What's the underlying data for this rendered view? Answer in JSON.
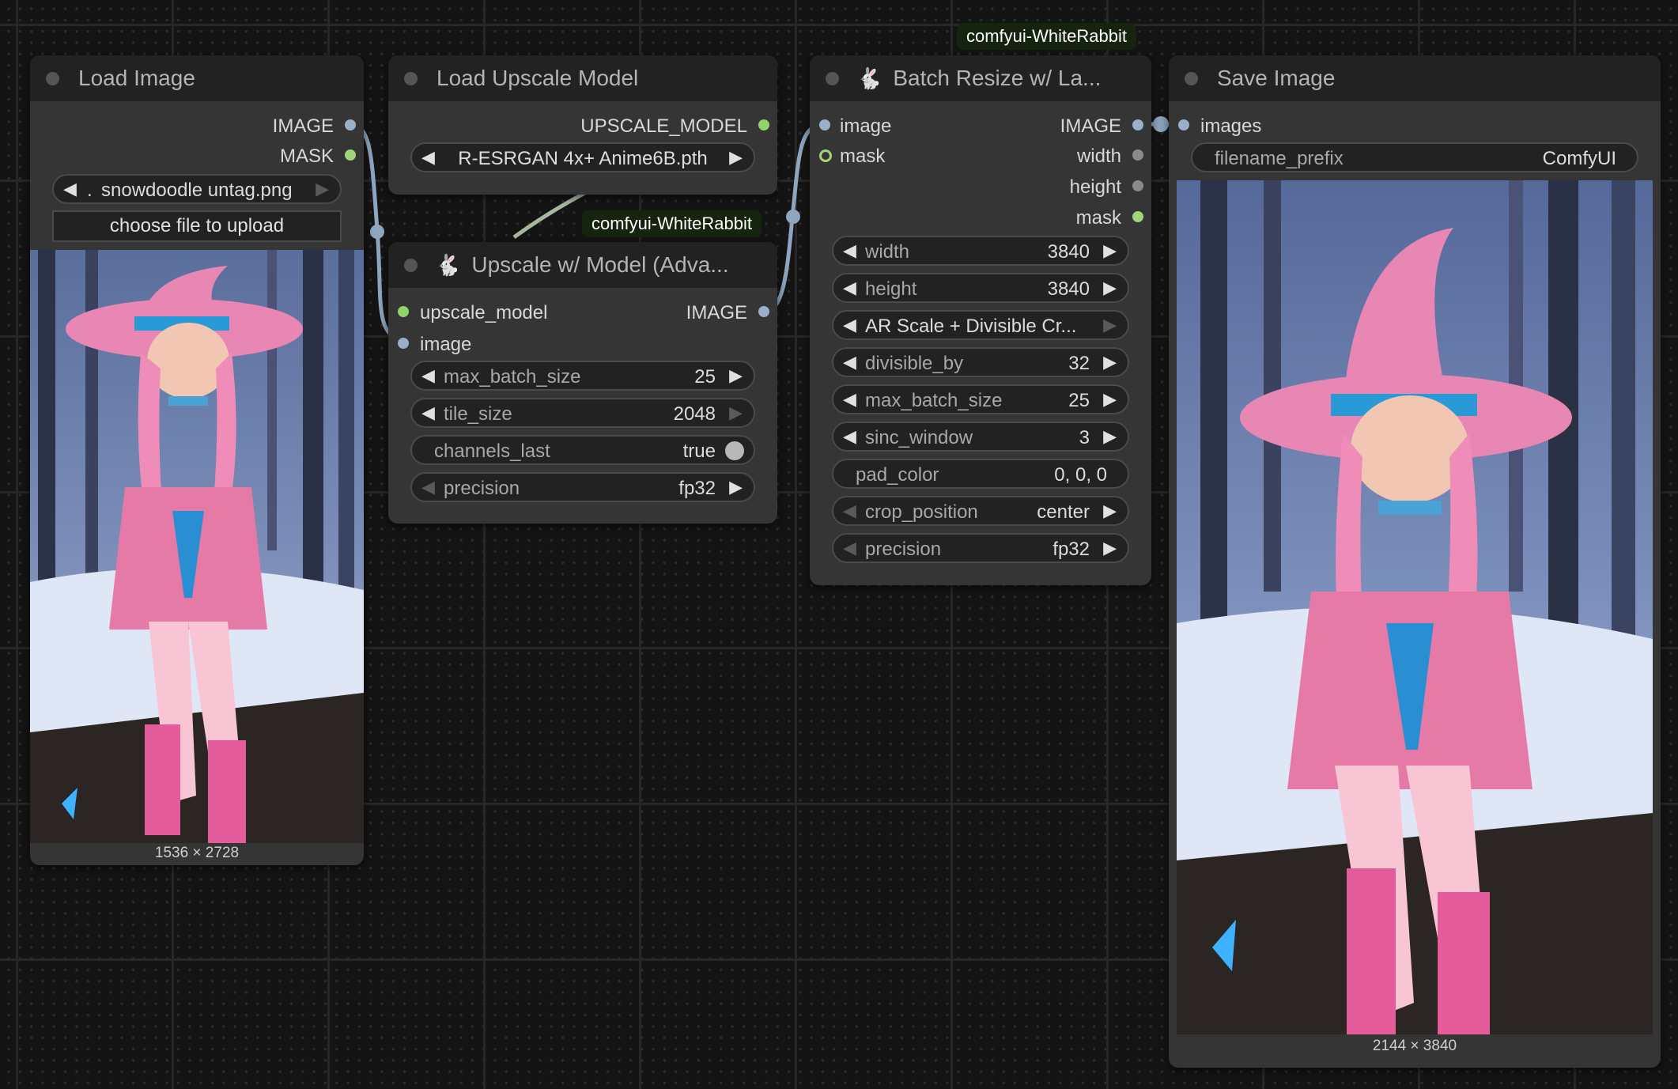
{
  "nodes": {
    "load_image": {
      "title": "Load Image",
      "outputs": [
        "IMAGE",
        "MASK"
      ],
      "file_value": "snowdoodle untag.png",
      "file_prefix": ".",
      "upload_label": "choose file to upload",
      "image_size": "1536 × 2728"
    },
    "load_upscale_model": {
      "title": "Load Upscale Model",
      "outputs": [
        "UPSCALE_MODEL"
      ],
      "model_value": "R-ESRGAN 4x+ Anime6B.pth"
    },
    "upscale_model": {
      "title": "Upscale w/ Model (Adva...",
      "badge": "comfyui-WhiteRabbit",
      "inputs": [
        "upscale_model",
        "image"
      ],
      "outputs": [
        "IMAGE"
      ],
      "widgets": [
        {
          "label": "max_batch_size",
          "value": "25"
        },
        {
          "label": "tile_size",
          "value": "2048"
        },
        {
          "label": "channels_last",
          "value": "true"
        },
        {
          "label": "precision",
          "value": "fp32"
        }
      ]
    },
    "batch_resize": {
      "title": "Batch Resize w/ La...",
      "badge": "comfyui-WhiteRabbit",
      "inputs": [
        "image",
        "mask"
      ],
      "outputs": [
        "IMAGE",
        "width",
        "height",
        "mask"
      ],
      "widgets": [
        {
          "label": "width",
          "value": "3840"
        },
        {
          "label": "height",
          "value": "3840"
        },
        {
          "label": "AR Scale + Divisible Cr...",
          "value": ""
        },
        {
          "label": "divisible_by",
          "value": "32"
        },
        {
          "label": "max_batch_size",
          "value": "25"
        },
        {
          "label": "sinc_window",
          "value": "3"
        },
        {
          "label": "pad_color",
          "value": "0, 0, 0"
        },
        {
          "label": "crop_position",
          "value": "center"
        },
        {
          "label": "precision",
          "value": "fp32"
        }
      ]
    },
    "save_image": {
      "title": "Save Image",
      "inputs": [
        "images"
      ],
      "filename_label": "filename_prefix",
      "filename_value": "ComfyUI",
      "image_size": "2144 × 3840"
    }
  },
  "colors": {
    "canvas": "#141414",
    "node_body": "#353535",
    "node_header": "#222222",
    "link_image": "#9ab0c8",
    "link_model": "#a8c3a0",
    "badge_bg": "#15240f"
  },
  "icons": {
    "rabbit": "rabbit-icon",
    "arrows": "triangle-arrow-icon"
  }
}
